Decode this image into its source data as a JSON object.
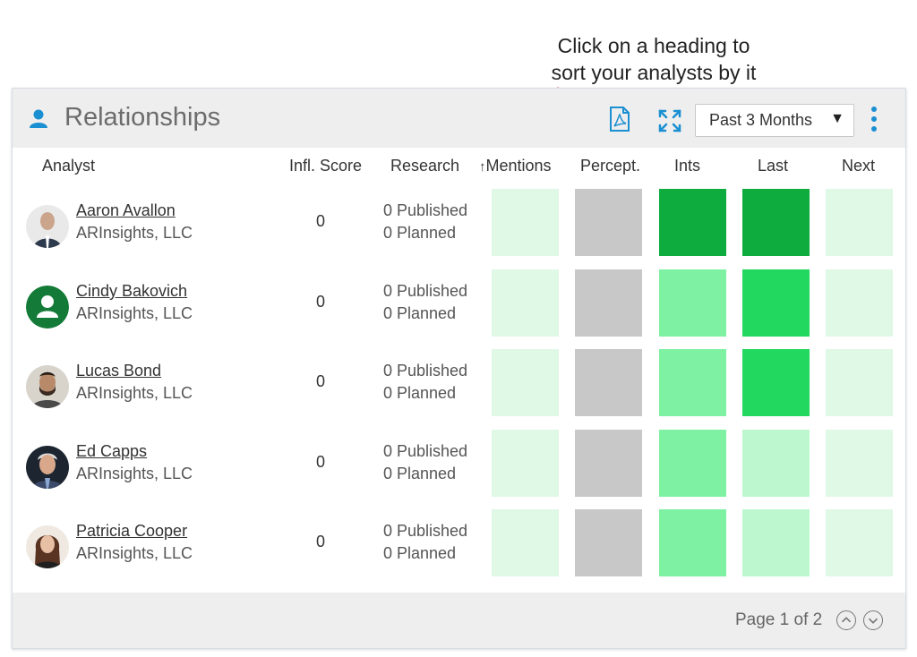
{
  "callout": {
    "line1": "Click on a heading to",
    "line2": "sort your analysts by it"
  },
  "header": {
    "icon": "person-icon",
    "title": "Relationships",
    "pdf_icon": "pdf-icon",
    "expand_icon": "expand-icon",
    "range_value": "Past 3 Months",
    "range_caret": "▼",
    "more_icon": "kebab-menu-icon"
  },
  "columns": {
    "analyst": "Analyst",
    "score": "Infl. Score",
    "research": "Research",
    "mentions_sort": "↑",
    "mentions": "Mentions",
    "percept": "Percept.",
    "ints": "Ints",
    "last": "Last",
    "next": "Next"
  },
  "rows": [
    {
      "name": "Aaron Avallon",
      "company": "ARInsights, LLC",
      "score": "0",
      "published": "0 Published",
      "planned": "0 Planned",
      "cells": {
        "mentions": "#e0f8e6",
        "percept": "#c8c8c8",
        "ints": "#0eab3f",
        "last": "#0eab3f",
        "next": "#e0f8e6"
      }
    },
    {
      "name": "Cindy Bakovich",
      "company": "ARInsights, LLC",
      "score": "0",
      "published": "0 Published",
      "planned": "0 Planned",
      "cells": {
        "mentions": "#e0f8e6",
        "percept": "#c8c8c8",
        "ints": "#7ef1a2",
        "last": "#22d85f",
        "next": "#e0f8e6"
      }
    },
    {
      "name": "Lucas Bond",
      "company": "ARInsights, LLC",
      "score": "0",
      "published": "0 Published",
      "planned": "0 Planned",
      "cells": {
        "mentions": "#e0f8e6",
        "percept": "#c8c8c8",
        "ints": "#7ef1a2",
        "last": "#22d85f",
        "next": "#e0f8e6"
      }
    },
    {
      "name": "Ed Capps",
      "company": "ARInsights, LLC",
      "score": "0",
      "published": "0 Published",
      "planned": "0 Planned",
      "cells": {
        "mentions": "#e0f8e6",
        "percept": "#c8c8c8",
        "ints": "#7ef1a2",
        "last": "#bdf7cf",
        "next": "#e0f8e6"
      }
    },
    {
      "name": "Patricia Cooper",
      "company": "ARInsights, LLC",
      "score": "0",
      "published": "0 Published",
      "planned": "0 Planned",
      "cells": {
        "mentions": "#e0f8e6",
        "percept": "#c8c8c8",
        "ints": "#7ef1a2",
        "last": "#bdf7cf",
        "next": "#e0f8e6"
      }
    }
  ],
  "footer": {
    "page_label": "Page 1 of 2",
    "prev_icon": "chevron-up-circle-icon",
    "next_icon": "chevron-down-circle-icon"
  },
  "colors": {
    "accent": "#1a8fd1",
    "annotation_arrow": "#e8413c",
    "avatar_placeholder_bg": "#137a37"
  }
}
